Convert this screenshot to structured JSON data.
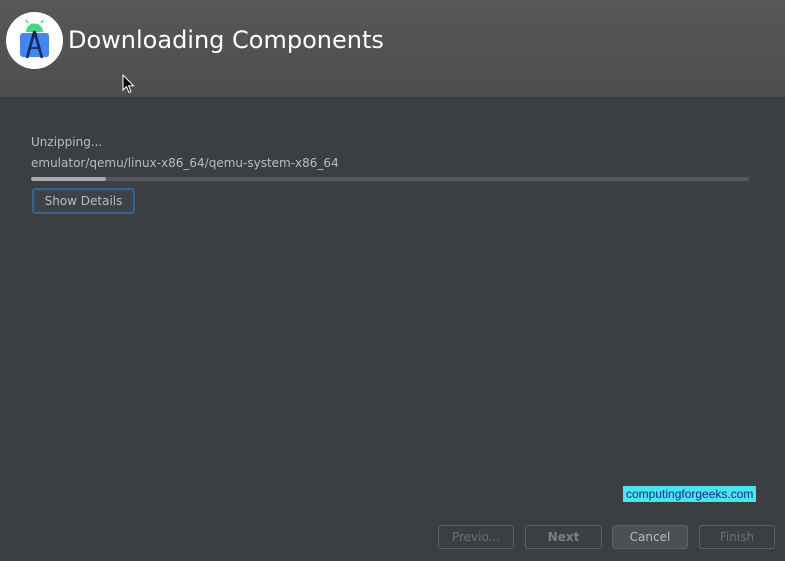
{
  "header": {
    "title": "Downloading Components",
    "logo_icon": "android-studio-icon"
  },
  "progress": {
    "status": "Unzipping...",
    "path": "emulator/qemu/linux-x86_64/qemu-system-x86_64",
    "fraction": 0.105
  },
  "details_button": {
    "label": "Show Details"
  },
  "watermark": {
    "text": "computingforgeeks.com"
  },
  "nav": {
    "previous": "Previo...",
    "next": "Next",
    "cancel": "Cancel",
    "finish": "Finish"
  },
  "colors": {
    "background": "#3c3f41",
    "header": "#525355",
    "accent_border": "#3d6185",
    "watermark_bg": "#47e5ee"
  }
}
